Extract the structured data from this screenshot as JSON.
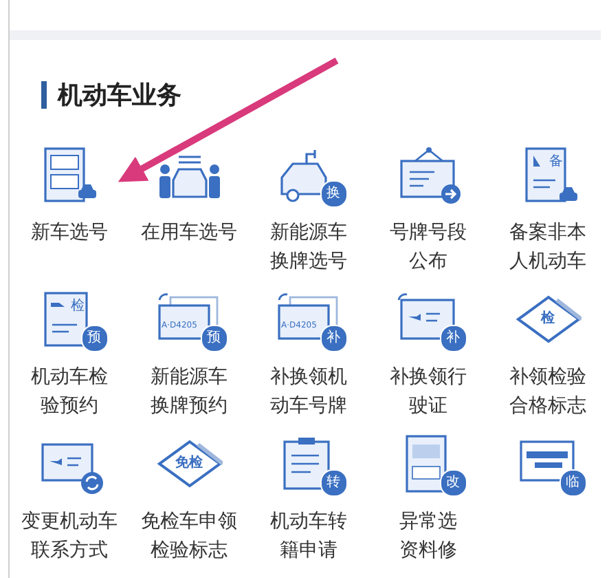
{
  "section": {
    "title": "机动车业务"
  },
  "annotation": {
    "kind": "arrow"
  },
  "services": [
    {
      "lines": [
        "新车选号"
      ],
      "kind": "plate-doc"
    },
    {
      "lines": [
        "在用车选号"
      ],
      "kind": "people-car"
    },
    {
      "lines": [
        "新能源车",
        "换牌选号"
      ],
      "kind": "ev-car",
      "badge": "换"
    },
    {
      "lines": [
        "号牌号段",
        "公布"
      ],
      "kind": "sign"
    },
    {
      "lines": [
        "备案非本",
        "人机动车"
      ],
      "kind": "doc-car",
      "mark": "备"
    },
    {
      "lines": [
        "机动车检",
        "验预约"
      ],
      "kind": "doc-badge",
      "mark": "检",
      "badge": "预"
    },
    {
      "lines": [
        "新能源车",
        "换牌预约"
      ],
      "kind": "plates",
      "plate": "A·D4205",
      "badge": "预"
    },
    {
      "lines": [
        "补换领机",
        "动车号牌"
      ],
      "kind": "plates",
      "plate": "A·D4205",
      "badge": "补"
    },
    {
      "lines": [
        "补换领行",
        "驶证"
      ],
      "kind": "card",
      "badge": "补"
    },
    {
      "lines": [
        "补领检验",
        "合格标志"
      ],
      "kind": "diamond",
      "mark": "检"
    },
    {
      "lines": [
        "变更机动车",
        "联系方式"
      ],
      "kind": "card-sync"
    },
    {
      "lines": [
        "免检车申领",
        "检验标志"
      ],
      "kind": "diamond",
      "mark": "免检"
    },
    {
      "lines": [
        "机动车转",
        "籍申请"
      ],
      "kind": "clipboard",
      "badge": "转"
    },
    {
      "lines": [
        "异常选",
        "资料修"
      ],
      "kind": "doc-plates",
      "badge": "改"
    },
    {
      "kind": "banner",
      "badge": "临"
    }
  ]
}
